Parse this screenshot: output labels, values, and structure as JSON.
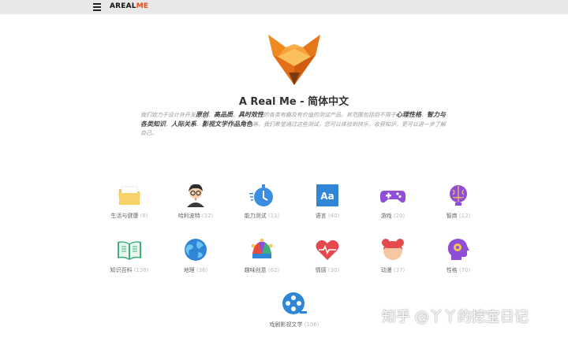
{
  "header": {
    "brand_main": "AREAL",
    "brand_accent": "ME",
    "accent_color": "#e84d1c"
  },
  "hero": {
    "title": "A Real Me - 简体中文",
    "intro": [
      {
        "t": "我们致力于设计并开发"
      },
      {
        "t": "原创",
        "b": true
      },
      {
        "t": "、"
      },
      {
        "t": "高品质",
        "b": true
      },
      {
        "t": "、"
      },
      {
        "t": "具时效性",
        "b": true
      },
      {
        "t": "的各类有趣及有价值的测试产品。其范围包括但不限于"
      },
      {
        "t": "心理性格",
        "b": true
      },
      {
        "t": "、"
      },
      {
        "t": "智力与各类知识",
        "b": true
      },
      {
        "t": "、"
      },
      {
        "t": "人际关系",
        "b": true
      },
      {
        "t": "、"
      },
      {
        "t": "影视文学作品角色",
        "b": true
      },
      {
        "t": "等。我们希望通过这些测试，您可以体验到快乐，收获知识，更可以进一步了解自己。"
      }
    ]
  },
  "categories": [
    {
      "label": "生活与健康",
      "count": "(8)",
      "icon": "folder-icon"
    },
    {
      "label": "哈利波特",
      "count": "(32)",
      "icon": "harry-potter-icon"
    },
    {
      "label": "能力测试",
      "count": "(11)",
      "icon": "stopwatch-icon"
    },
    {
      "label": "语言",
      "count": "(40)",
      "icon": "language-icon"
    },
    {
      "label": "游戏",
      "count": "(20)",
      "icon": "gamepad-icon"
    },
    {
      "label": "智商",
      "count": "(12)",
      "icon": "brain-icon"
    },
    {
      "label": "知识百科",
      "count": "(138)",
      "icon": "book-icon"
    },
    {
      "label": "地理",
      "count": "(36)",
      "icon": "globe-icon"
    },
    {
      "label": "趣味创意",
      "count": "(62)",
      "icon": "jester-icon"
    },
    {
      "label": "情感",
      "count": "(30)",
      "icon": "heart-icon"
    },
    {
      "label": "动漫",
      "count": "(37)",
      "icon": "anime-icon"
    },
    {
      "label": "性格",
      "count": "(70)",
      "icon": "personality-icon"
    },
    {
      "label": "戏剧影视文学",
      "count": "(106)",
      "icon": "film-icon"
    }
  ],
  "watermark": "知乎 @丫丫的挖宝日记"
}
